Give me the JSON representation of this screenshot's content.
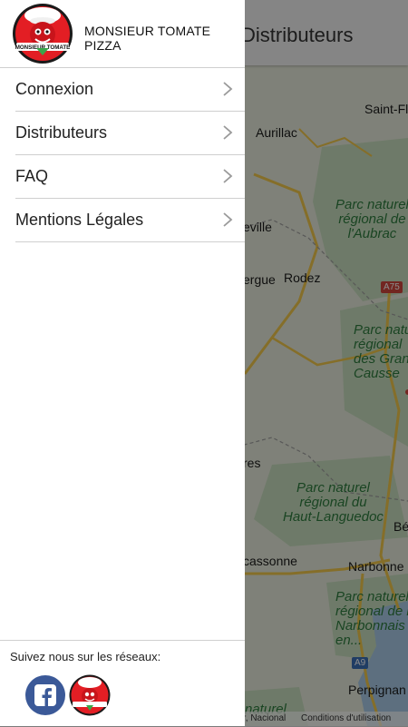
{
  "app": {
    "title": "Distributeurs"
  },
  "brand": {
    "name_line1": "MONSIEUR TOMATE",
    "name_line2": "PIZZA",
    "logo_text": "MONSIEUR TOMATE"
  },
  "menu": [
    {
      "label": "Connexion"
    },
    {
      "label": "Distributeurs"
    },
    {
      "label": "FAQ"
    },
    {
      "label": "Mentions Légales"
    }
  ],
  "footer": {
    "follow_text": "Suivez nous sur les réseaux:"
  },
  "map": {
    "labels": {
      "saint_flour": "Saint-Flo",
      "aurillac": "Aurillac",
      "aubrac_1": "Parc naturel",
      "aubrac_2": "régional de",
      "aubrac_3": "l'Aubrac",
      "eville": "eville",
      "ergue": "ergue",
      "rodez": "Rodez",
      "a75": "A75",
      "causses_1": "Parc natu",
      "causses_2": "régional",
      "causses_3": "des Gran",
      "causses_4": "Causse",
      "res": "res",
      "hl_1": "Parc naturel",
      "hl_2": "régional du",
      "hl_3": "Haut-Languedoc",
      "be": "Bé",
      "carcassonne": "cassonne",
      "narbonne": "Narbonne",
      "narb_1": "Parc naturel",
      "narb_2": "régional de l",
      "narb_3": "Narbonnais",
      "narb_4": "en...",
      "a9": "A9",
      "perpignan": "Perpignan",
      "naturel": "naturel"
    },
    "footer_left": "r, Nacional",
    "footer_right": "Conditions d'utilisation"
  },
  "colors": {
    "accent": "#e31e24",
    "facebook": "#3b5998",
    "overlay": "rgba(0,0,0,0.45)"
  }
}
